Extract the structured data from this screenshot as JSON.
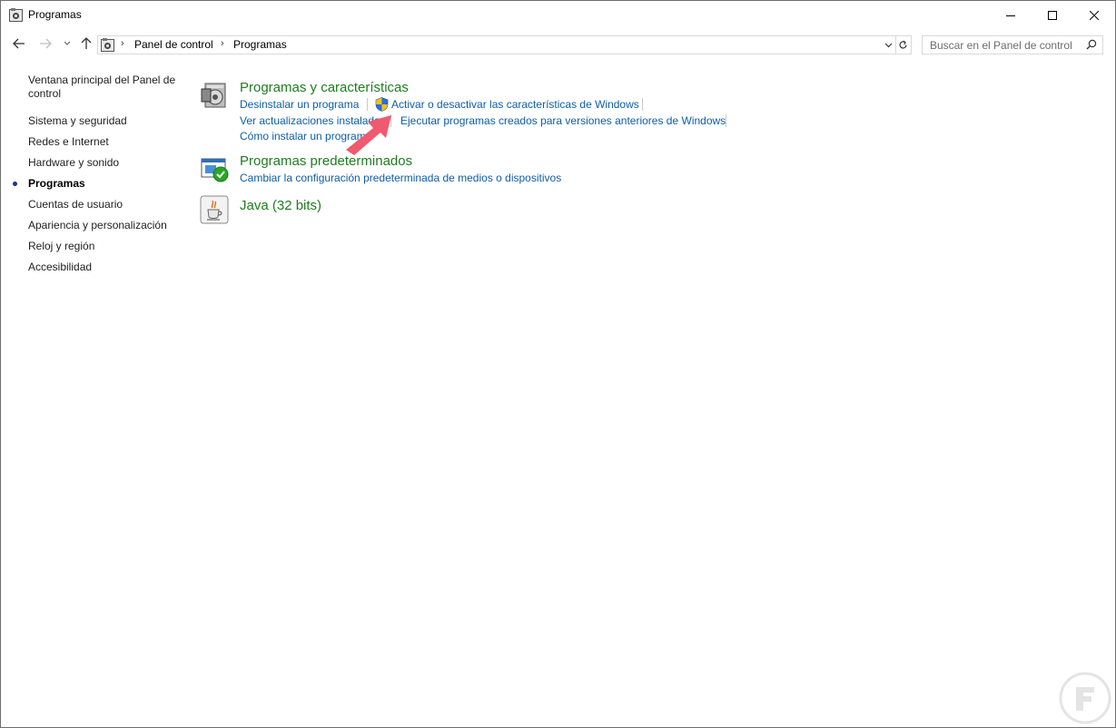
{
  "window": {
    "title": "Programas"
  },
  "address": {
    "crumbs": [
      "Panel de control",
      "Programas"
    ],
    "separator": "›"
  },
  "search": {
    "placeholder": "Buscar en el Panel de control"
  },
  "leftnav": {
    "items": [
      {
        "label": "Ventana principal del Panel de control",
        "current": false
      },
      {
        "label": "Sistema y seguridad",
        "current": false
      },
      {
        "label": "Redes e Internet",
        "current": false
      },
      {
        "label": "Hardware y sonido",
        "current": false
      },
      {
        "label": "Programas",
        "current": true
      },
      {
        "label": "Cuentas de usuario",
        "current": false
      },
      {
        "label": "Apariencia y personalización",
        "current": false
      },
      {
        "label": "Reloj y región",
        "current": false
      },
      {
        "label": "Accesibilidad",
        "current": false
      }
    ]
  },
  "categories": {
    "programs_features": {
      "title": "Programas y características",
      "links": {
        "uninstall": "Desinstalar un programa",
        "windows_features": "Activar o desactivar las características de Windows",
        "view_updates": "Ver actualizaciones instaladas",
        "compat": "Ejecutar programas creados para versiones anteriores de Windows",
        "how_install": "Cómo instalar un programa"
      }
    },
    "default_programs": {
      "title": "Programas predeterminados",
      "links": {
        "change_defaults": "Cambiar la configuración predeterminada de medios o dispositivos"
      }
    },
    "java": {
      "title": "Java (32 bits)"
    }
  },
  "colors": {
    "category_title": "#1e7d1e",
    "link": "#0e5da8",
    "annotation_arrow": "#f05a6e"
  },
  "icons": {
    "title": "control-panel-icon",
    "programs_features": "programs-disk-icon",
    "default_programs": "default-programs-check-icon",
    "java": "java-cup-icon",
    "shield": "uac-shield-icon"
  }
}
